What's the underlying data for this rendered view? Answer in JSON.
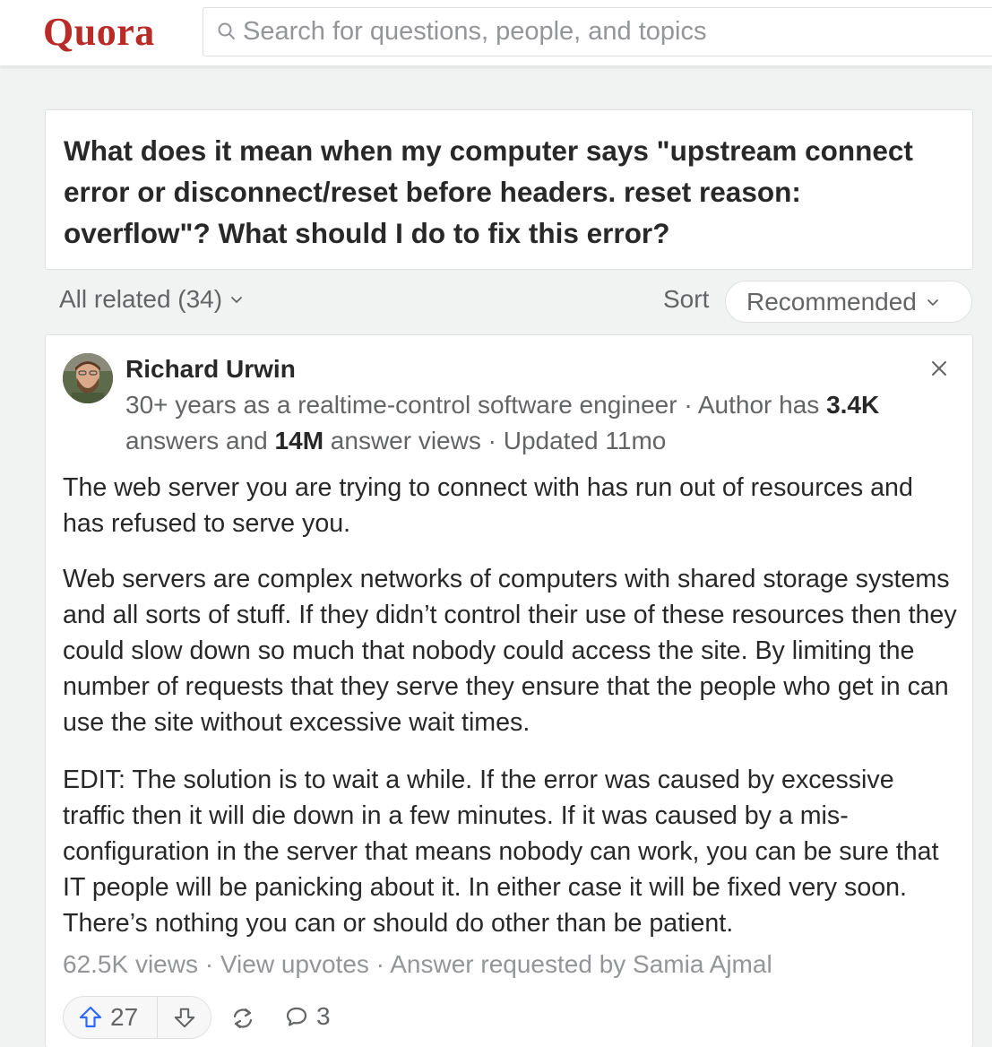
{
  "header": {
    "logo": "Quora",
    "search_placeholder": "Search for questions, people, and topics"
  },
  "question": {
    "title": "What does it mean when my computer says \"upstream connect error or disconnect/reset before headers. reset reason: overflow\"? What should I do to fix this error?"
  },
  "filters": {
    "all_related": "All related (34)",
    "sort_label": "Sort",
    "sort_value": "Recommended"
  },
  "answer": {
    "author": "Richard Urwin",
    "credential_part1": "30+ years as a realtime-control software engineer · Author has ",
    "answers_count": "3.4K",
    "credential_part2": " answers and ",
    "views_count": "14M",
    "credential_part3": " answer views · Updated 11mo",
    "paragraphs": [
      "The web server you are trying to connect with has run out of resources and has refused to serve you.",
      "Web servers are complex networks of computers with shared storage systems and all sorts of stuff. If they didn’t control their use of these resources then they could slow down so much that nobody could access the site. By limiting the number of requests that they serve they ensure that the people who get in can use the site without excessive wait times.",
      "EDIT: The solution is to wait a while. If the error was caused by excessive traffic then it will die down in a few minutes. If it was caused by a mis-configuration in the server that means nobody can work, you can be sure that IT people will be panicking about it. In either case it will be fixed very soon. There’s nothing you can or should do other than be patient."
    ],
    "views": "62.5K views",
    "sep": " · ",
    "view_upvotes": "View upvotes",
    "requested_by": "Answer requested by Samia Ajmal",
    "upvotes": "27",
    "comments": "3"
  },
  "colors": {
    "brand": "#b92b27",
    "upvote_icon": "#2e69ff",
    "text": "#282829",
    "secondary": "#636466",
    "muted": "#939598",
    "background": "#f1f2f2"
  },
  "icons": [
    "search-icon",
    "chevron-down-icon",
    "close-icon",
    "upvote-arrow-icon",
    "downvote-arrow-icon",
    "share-icon",
    "comment-icon"
  ]
}
